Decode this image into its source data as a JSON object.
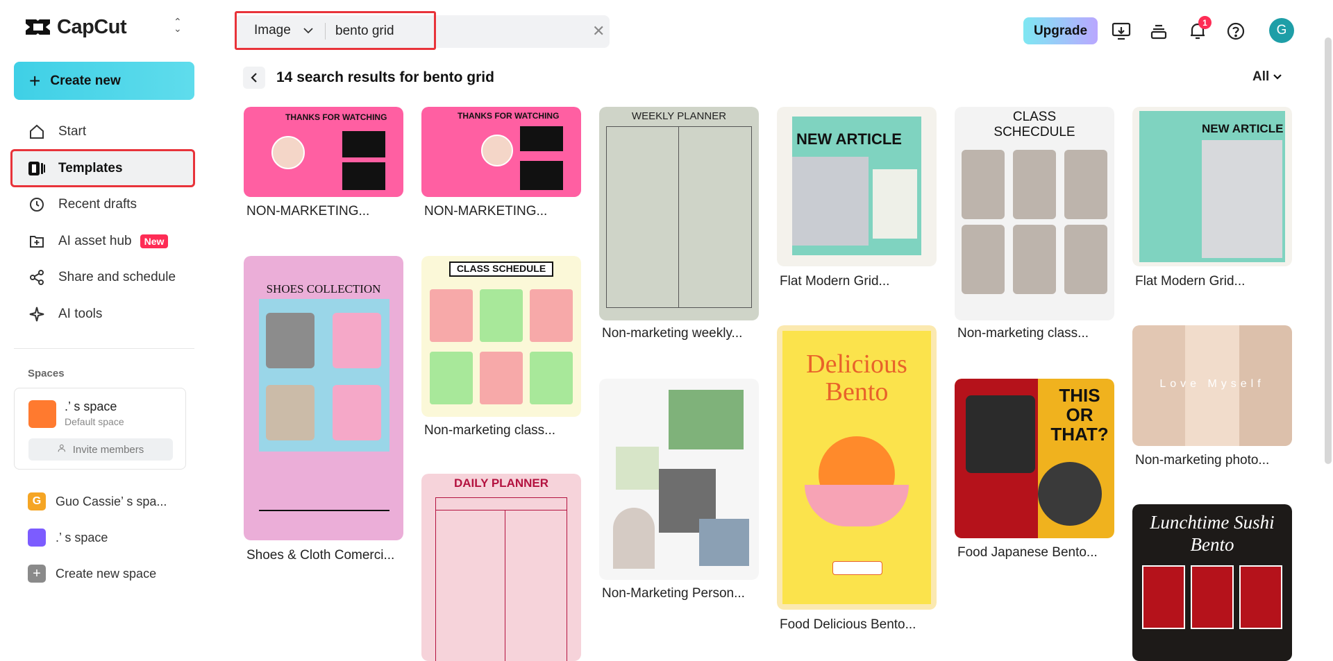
{
  "app": {
    "name": "CapCut"
  },
  "sidebar": {
    "create_label": "Create new",
    "nav": [
      {
        "label": "Start",
        "icon": "home-icon"
      },
      {
        "label": "Templates",
        "icon": "templates-icon"
      },
      {
        "label": "Recent drafts",
        "icon": "clock-icon"
      },
      {
        "label": "AI asset hub",
        "icon": "folder-plus-icon",
        "badge": "New"
      },
      {
        "label": "Share and schedule",
        "icon": "share-icon"
      },
      {
        "label": "AI tools",
        "icon": "sparkle-icon"
      }
    ],
    "spaces_title": "Spaces",
    "current_space": {
      "name": ".’ s space",
      "sub": "Default space",
      "invite": "Invite members"
    },
    "other_spaces": [
      {
        "label": "Guo Cassie’ s spa...",
        "initial": "G",
        "color": "#f5a524"
      },
      {
        "label": ".’ s space",
        "initial": "",
        "color": "#7c5cff"
      },
      {
        "label": "Create new space",
        "initial": "+",
        "color": "#8a8a8a"
      }
    ]
  },
  "topbar": {
    "search_type": "Image",
    "search_value": "bento grid",
    "upgrade_label": "Upgrade",
    "notification_count": "1",
    "avatar_initial": "G"
  },
  "results": {
    "title": "14 search results for bento grid",
    "filter": "All"
  },
  "templates": [
    {
      "title": "NON-MARKETING...",
      "overlay": "THANKS FOR WATCHING"
    },
    {
      "title": "NON-MARKETING...",
      "overlay": "THANKS FOR WATCHING"
    },
    {
      "title": "Non-marketing weekly...",
      "overlay": "WEEKLY PLANNER"
    },
    {
      "title": "Flat Modern Grid...",
      "overlay": "NEW ARTICLE"
    },
    {
      "title": "Non-marketing class...",
      "overlay": "CLASS SCHECDULE"
    },
    {
      "title": "Flat Modern Grid...",
      "overlay": "NEW ARTICLE"
    },
    {
      "title": "Shoes & Cloth Comerci...",
      "overlay": "SHOES COLLECTION"
    },
    {
      "title": "Non-marketing class...",
      "overlay": "CLASS SCHEDULE"
    },
    {
      "title": "Non-Marketing Person...",
      "overlay": ""
    },
    {
      "title": "Food Delicious Bento...",
      "overlay": "Delicious Bento"
    },
    {
      "title": "Food Japanese Bento...",
      "overlay": "THIS OR THAT?"
    },
    {
      "title": "Non-marketing photo...",
      "overlay": "Love Myself"
    },
    {
      "title": "",
      "overlay": "DAILY PLANNER"
    },
    {
      "title": "",
      "overlay": "Lunchtime Sushi Bento"
    }
  ]
}
